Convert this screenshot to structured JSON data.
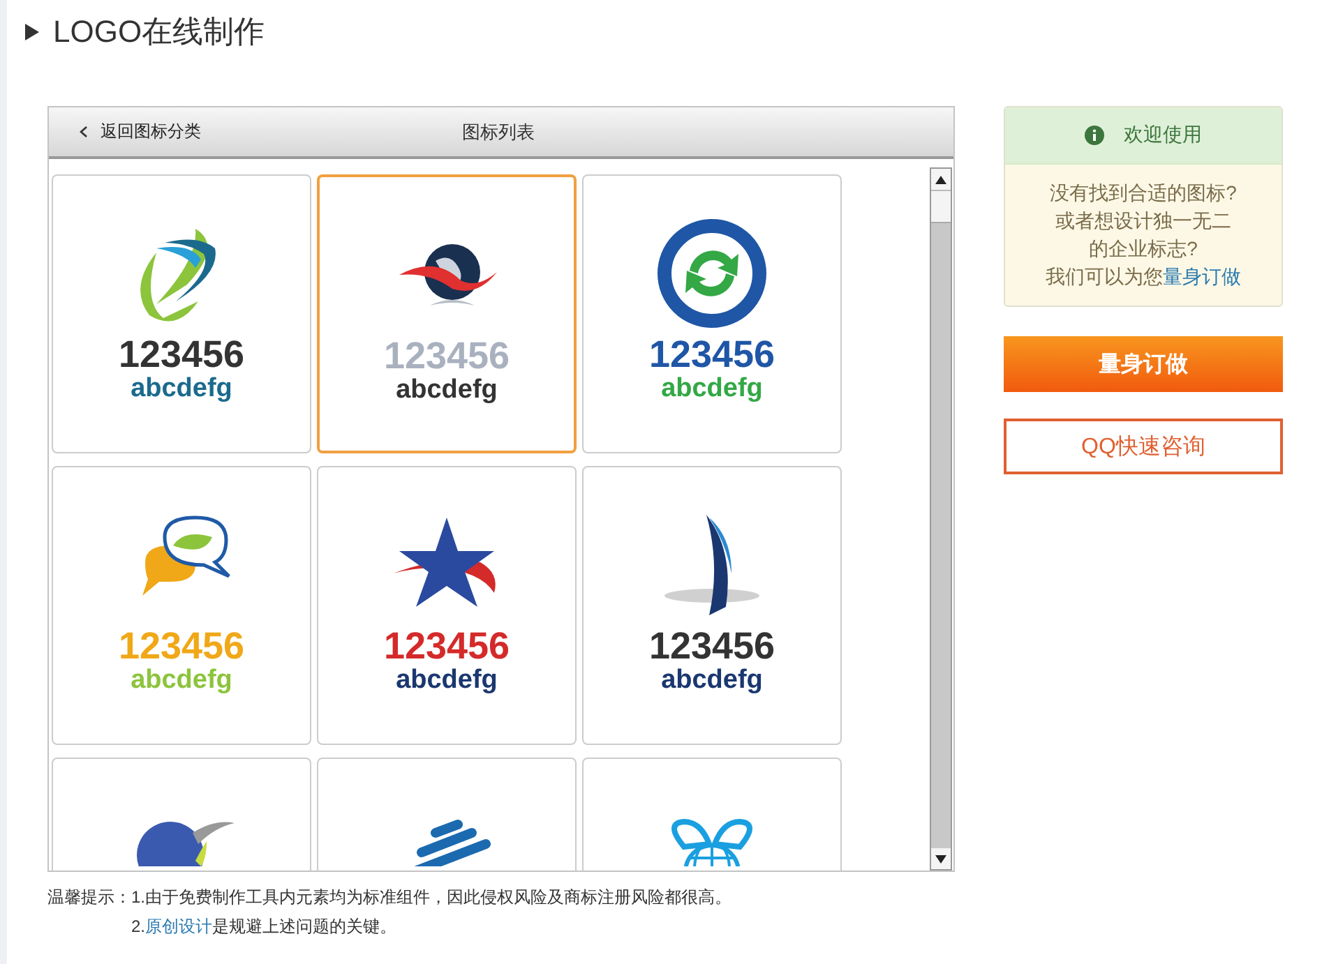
{
  "page_title": "LOGO在线制作",
  "panel": {
    "back_label": "返回图标分类",
    "title": "图标列表",
    "cards": [
      {
        "kind": "swoosh",
        "selected": false,
        "number": {
          "text": "123456",
          "color": "#333333"
        },
        "letters": {
          "text": "abcdefg",
          "color": "#1b6a8e"
        }
      },
      {
        "kind": "globe",
        "selected": true,
        "number": {
          "text": "123456",
          "color": "#a9b1bf"
        },
        "letters": {
          "text": "abcdefg",
          "color": "#333333"
        }
      },
      {
        "kind": "arrows",
        "selected": false,
        "number": {
          "text": "123456",
          "color": "#1f56a6"
        },
        "letters": {
          "text": "abcdefg",
          "color": "#33a845"
        }
      },
      {
        "kind": "speech",
        "selected": false,
        "number": {
          "text": "123456",
          "color": "#f0a818"
        },
        "letters": {
          "text": "abcdefg",
          "color": "#8cc43c"
        }
      },
      {
        "kind": "star",
        "selected": false,
        "number": {
          "text": "123456",
          "color": "#d42a2a"
        },
        "letters": {
          "text": "abcdefg",
          "color": "#1a3770"
        }
      },
      {
        "kind": "sail",
        "selected": false,
        "number": {
          "text": "123456",
          "color": "#333333"
        },
        "letters": {
          "text": "abcdefg",
          "color": "#1a3770"
        }
      },
      {
        "kind": "globe-ring",
        "selected": false
      },
      {
        "kind": "stripes",
        "selected": false
      },
      {
        "kind": "mesh-globe",
        "selected": false
      }
    ]
  },
  "welcome": {
    "title": "欢迎使用",
    "lines": [
      "没有找到合适的图标?",
      "或者想设计独一无二",
      "的企业标志?"
    ],
    "last_line": "我们可以为您",
    "link": "量身订做"
  },
  "buttons": {
    "primary": "量身订做",
    "secondary": "QQ快速咨询"
  },
  "tips": {
    "label": "温馨提示：",
    "line1": "1.由于免费制作工具内元素均为标准组件，因此侵权风险及商标注册风险都很高。",
    "line2_prefix": "2.",
    "line2_link": "原创设计",
    "line2_rest": "是规避上述问题的关键。"
  }
}
